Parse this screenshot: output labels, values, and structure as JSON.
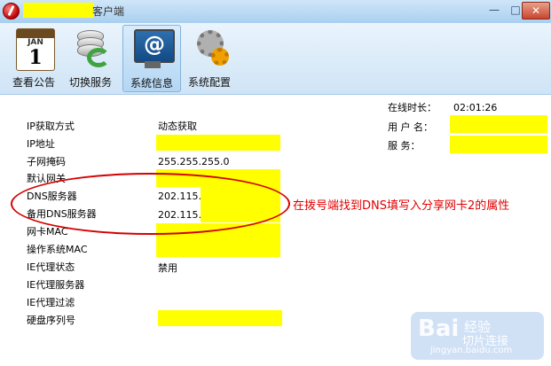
{
  "window": {
    "title_suffix": "客户端",
    "min": "—",
    "max": "□",
    "close": "✕"
  },
  "toolbar": {
    "items": [
      {
        "label": "查看公告",
        "icon": "calendar-icon"
      },
      {
        "label": "切换服务",
        "icon": "database-switch-icon"
      },
      {
        "label": "系统信息",
        "icon": "monitor-at-icon"
      },
      {
        "label": "系统配置",
        "icon": "gears-icon"
      }
    ],
    "calendar_month": "JAN",
    "calendar_day": "1",
    "monitor_symbol": "@"
  },
  "info": {
    "rows": [
      {
        "label": "IP获取方式",
        "value": "动态获取"
      },
      {
        "label": "IP地址",
        "value": ""
      },
      {
        "label": "子网掩码",
        "value": "255.255.255.0"
      },
      {
        "label": "默认网关",
        "value": ""
      },
      {
        "label": "DNS服务器",
        "value": "202.115."
      },
      {
        "label": "备用DNS服务器",
        "value": "202.115."
      },
      {
        "label": "网卡MAC",
        "value": ""
      },
      {
        "label": "操作系统MAC",
        "value": ""
      },
      {
        "label": "IE代理状态",
        "value": "禁用"
      },
      {
        "label": "IE代理服务器",
        "value": ""
      },
      {
        "label": "IE代理过滤",
        "value": ""
      },
      {
        "label": "硬盘序列号",
        "value": ""
      }
    ]
  },
  "status": {
    "online_label": "在线时长：",
    "online_value": "02:01:26",
    "user_label": "用 户 名：",
    "service_label": "服    务："
  },
  "annotation": "在拨号端找到DNS填写入分享网卡2的属性",
  "watermark": {
    "brand": "Bai",
    "text": "经验",
    "url": "jingyan.baidu.com",
    "overlay": "切片连接"
  },
  "colors": {
    "redaction": "#ffff00",
    "annotation": "#e00000"
  }
}
